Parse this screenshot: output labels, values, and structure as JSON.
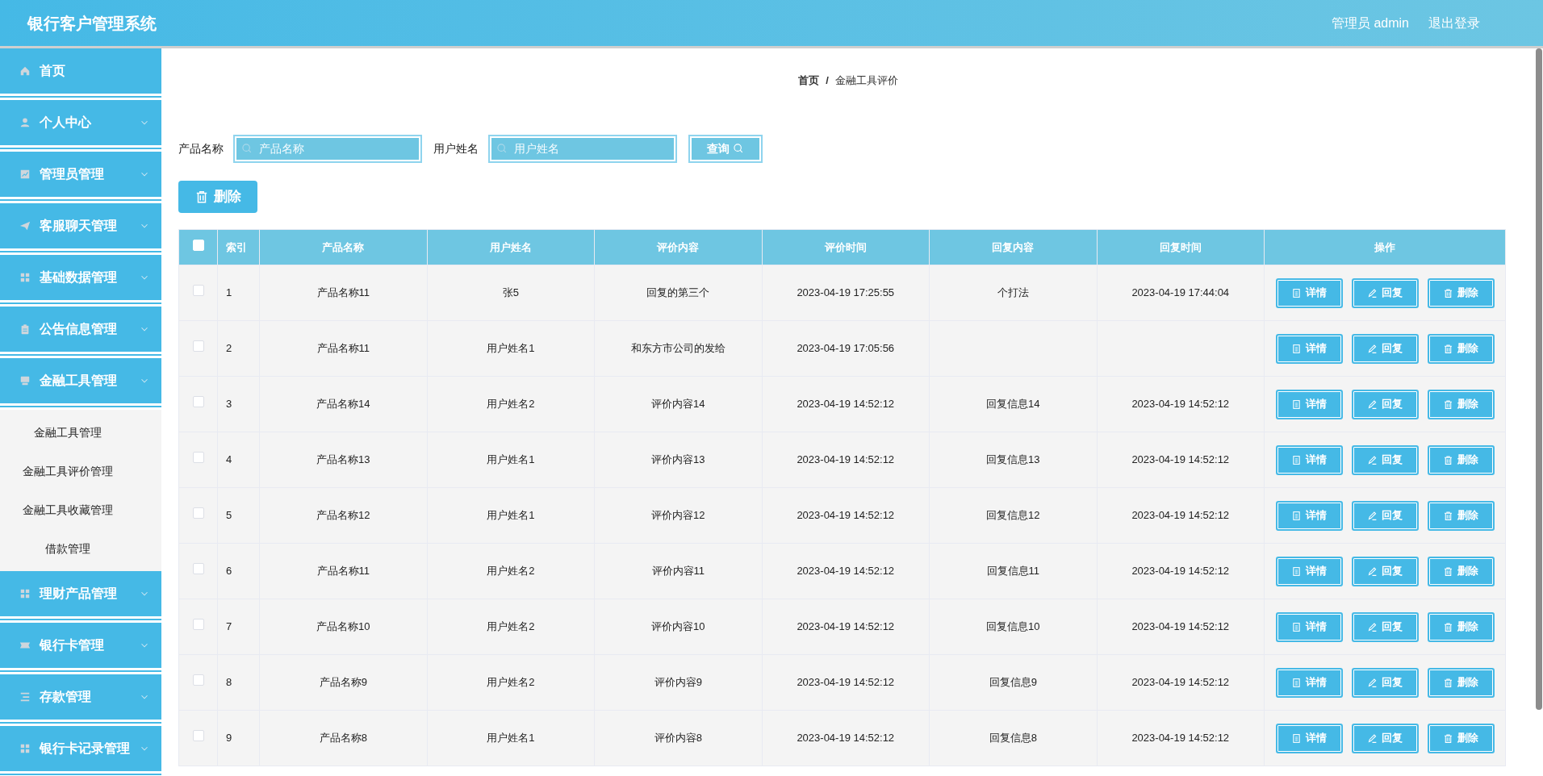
{
  "header": {
    "title": "银行客户管理系统",
    "user": "管理员 admin",
    "logout": "退出登录"
  },
  "sidebar": {
    "items": [
      {
        "label": "首页",
        "kind": "link"
      },
      {
        "label": "个人中心",
        "kind": "menu"
      },
      {
        "label": "管理员管理",
        "kind": "menu"
      },
      {
        "label": "客服聊天管理",
        "kind": "menu"
      },
      {
        "label": "基础数据管理",
        "kind": "menu"
      },
      {
        "label": "公告信息管理",
        "kind": "menu"
      },
      {
        "label": "金融工具管理",
        "kind": "menu",
        "expanded": true,
        "children": [
          {
            "label": "金融工具管理"
          },
          {
            "label": "金融工具评价管理"
          },
          {
            "label": "金融工具收藏管理"
          },
          {
            "label": "借款管理"
          }
        ]
      },
      {
        "label": "理财产品管理",
        "kind": "menu"
      },
      {
        "label": "银行卡管理",
        "kind": "menu"
      },
      {
        "label": "存款管理",
        "kind": "menu"
      },
      {
        "label": "银行卡记录管理",
        "kind": "menu"
      }
    ]
  },
  "breadcrumb": [
    "首页",
    "/",
    "金融工具评价"
  ],
  "search": {
    "fields": [
      {
        "label": "产品名称",
        "placeholder": "产品名称"
      },
      {
        "label": "用户姓名",
        "placeholder": "用户姓名"
      }
    ],
    "button": "查询"
  },
  "delete_button": "删除",
  "table": {
    "select_all": {
      "checked": false
    },
    "columns": [
      "索引",
      "产品名称",
      "用户姓名",
      "评价内容",
      "评价时间",
      "回复内容",
      "回复时间",
      "操作"
    ],
    "rows": [
      {
        "checked": false,
        "cells": [
          "1",
          "产品名称11",
          "张5",
          "回复的第三个",
          "2023-04-19 17:25:55",
          "个打法",
          "2023-04-19 17:44:04"
        ],
        "actions": [
          "详情",
          "回复",
          "删除"
        ]
      },
      {
        "checked": false,
        "cells": [
          "2",
          "产品名称11",
          "用户姓名1",
          "和东方市公司的发给",
          "2023-04-19 17:05:56",
          null,
          null
        ],
        "actions": [
          "详情",
          "回复",
          "删除"
        ]
      },
      {
        "checked": false,
        "cells": [
          "3",
          "产品名称14",
          "用户姓名2",
          "评价内容14",
          "2023-04-19 14:52:12",
          "回复信息14",
          "2023-04-19 14:52:12"
        ],
        "actions": [
          "详情",
          "回复",
          "删除"
        ]
      },
      {
        "checked": false,
        "cells": [
          "4",
          "产品名称13",
          "用户姓名1",
          "评价内容13",
          "2023-04-19 14:52:12",
          "回复信息13",
          "2023-04-19 14:52:12"
        ],
        "actions": [
          "详情",
          "回复",
          "删除"
        ]
      },
      {
        "checked": false,
        "cells": [
          "5",
          "产品名称12",
          "用户姓名1",
          "评价内容12",
          "2023-04-19 14:52:12",
          "回复信息12",
          "2023-04-19 14:52:12"
        ],
        "actions": [
          "详情",
          "回复",
          "删除"
        ]
      },
      {
        "checked": false,
        "cells": [
          "6",
          "产品名称11",
          "用户姓名2",
          "评价内容11",
          "2023-04-19 14:52:12",
          "回复信息11",
          "2023-04-19 14:52:12"
        ],
        "actions": [
          "详情",
          "回复",
          "删除"
        ]
      },
      {
        "checked": false,
        "cells": [
          "7",
          "产品名称10",
          "用户姓名2",
          "评价内容10",
          "2023-04-19 14:52:12",
          "回复信息10",
          "2023-04-19 14:52:12"
        ],
        "actions": [
          "详情",
          "回复",
          "删除"
        ]
      },
      {
        "checked": false,
        "cells": [
          "8",
          "产品名称9",
          "用户姓名2",
          "评价内容9",
          "2023-04-19 14:52:12",
          "回复信息9",
          "2023-04-19 14:52:12"
        ],
        "actions": [
          "详情",
          "回复",
          "删除"
        ]
      },
      {
        "checked": false,
        "cells": [
          "9",
          "产品名称8",
          "用户姓名1",
          "评价内容8",
          "2023-04-19 14:52:12",
          "回复信息8",
          "2023-04-19 14:52:12"
        ],
        "actions": [
          "详情",
          "回复",
          "删除"
        ]
      }
    ]
  }
}
